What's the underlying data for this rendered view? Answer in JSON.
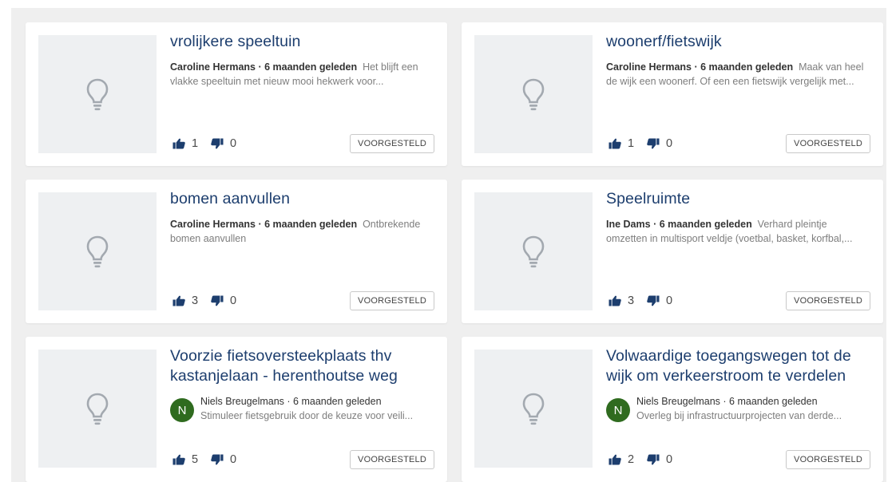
{
  "cards": [
    {
      "title": "vrolijkere speeltuin",
      "author": "Caroline Hermans",
      "time": "6 maanden geleden",
      "description": "Het blijft een vlakke speeltuin met nieuw mooi hekwerk voor...",
      "upvotes": "1",
      "downvotes": "0",
      "status": "VOORGESTELD"
    },
    {
      "title": "woonerf/fietswijk",
      "author": "Caroline Hermans",
      "time": "6 maanden geleden",
      "description": "Maak van heel de wijk een woonerf. Of een een fietswijk vergelijk met...",
      "upvotes": "1",
      "downvotes": "0",
      "status": "VOORGESTELD"
    },
    {
      "title": "bomen aanvullen",
      "author": "Caroline Hermans",
      "time": "6 maanden geleden",
      "description": "Ontbrekende bomen aanvullen",
      "upvotes": "3",
      "downvotes": "0",
      "status": "VOORGESTELD"
    },
    {
      "title": "Speelruimte",
      "author": "Ine Dams",
      "time": "6 maanden geleden",
      "description": "Verhard pleintje omzetten in multisport veldje (voetbal, basket, korfbal,...",
      "upvotes": "3",
      "downvotes": "0",
      "status": "VOORGESTELD"
    },
    {
      "title": "Voorzie fietsoversteekplaats thv kastanjelaan - herenthoutse weg",
      "author": "Niels Breugelmans",
      "avatar_letter": "N",
      "time": "6 maanden geleden",
      "description": "Stimuleer fietsgebruik door de keuze voor veili...",
      "upvotes": "5",
      "downvotes": "0",
      "status": "VOORGESTELD"
    },
    {
      "title": "Volwaardige toegangswegen tot de wijk om verkeerstroom te verdelen",
      "author": "Niels Breugelmans",
      "avatar_letter": "N",
      "time": "6 maanden geleden",
      "description": "Overleg bij infrastructuurprojecten van derde...",
      "upvotes": "2",
      "downvotes": "0",
      "status": "VOORGESTELD"
    }
  ],
  "separator": " · ",
  "colors": {
    "title": "#1d3e6e",
    "avatar": "#2f6b1f",
    "background": "#efefef",
    "thumbnail": "#eef0f2"
  },
  "icons": {
    "thumbnail": "lightbulb-icon",
    "upvote": "thumbs-up-icon",
    "downvote": "thumbs-down-icon"
  }
}
